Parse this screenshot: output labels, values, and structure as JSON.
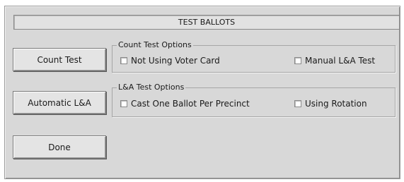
{
  "dialog": {
    "title": "TEST BALLOTS"
  },
  "buttons": {
    "count_test": "Count Test",
    "automatic_la": "Automatic L&A",
    "done": "Done"
  },
  "count_test_options": {
    "legend": "Count Test Options",
    "not_using_voter_card": {
      "label": "Not Using Voter Card",
      "checked": false
    },
    "manual_la_test": {
      "label": "Manual L&A Test",
      "checked": false
    }
  },
  "la_test_options": {
    "legend": "L&A Test Options",
    "cast_one_ballot": {
      "label": "Cast One Ballot Per Precinct",
      "checked": false
    },
    "using_rotation": {
      "label": "Using Rotation",
      "checked": false
    }
  }
}
